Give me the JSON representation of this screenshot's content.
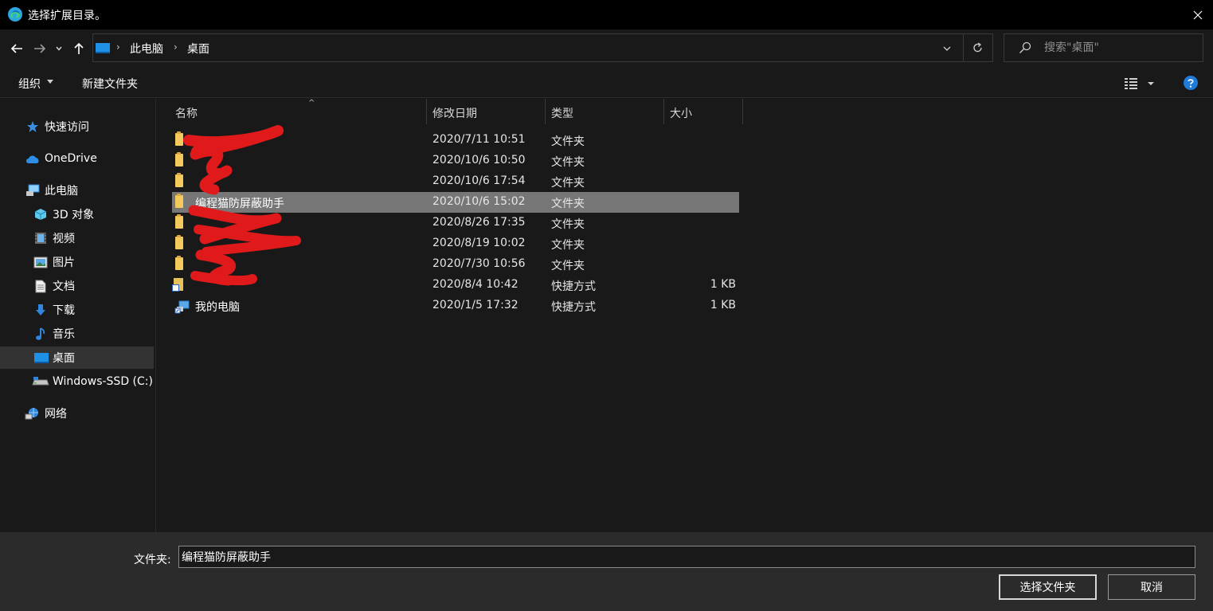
{
  "window": {
    "title": "选择扩展目录。"
  },
  "breadcrumb": {
    "items": [
      "此电脑",
      "桌面"
    ]
  },
  "search": {
    "placeholder": "搜索\"桌面\""
  },
  "toolbar": {
    "organize_label": "组织",
    "new_folder_label": "新建文件夹"
  },
  "sidebar": {
    "items": [
      {
        "label": "快速访问",
        "icon": "star-icon"
      },
      {
        "label": "OneDrive",
        "icon": "cloud-icon"
      },
      {
        "label": "此电脑",
        "icon": "computer-icon"
      },
      {
        "label": "3D 对象",
        "icon": "cube-icon"
      },
      {
        "label": "视频",
        "icon": "video-icon"
      },
      {
        "label": "图片",
        "icon": "picture-icon"
      },
      {
        "label": "文档",
        "icon": "document-icon"
      },
      {
        "label": "下载",
        "icon": "download-icon"
      },
      {
        "label": "音乐",
        "icon": "music-icon"
      },
      {
        "label": "桌面",
        "icon": "desktop-icon"
      },
      {
        "label": "Windows-SSD (C:)",
        "icon": "drive-icon"
      },
      {
        "label": "网络",
        "icon": "network-icon"
      }
    ],
    "selected": "桌面"
  },
  "columns": {
    "name": "名称",
    "date": "修改日期",
    "type": "类型",
    "size": "大小"
  },
  "files": [
    {
      "name": "",
      "date": "2020/7/11 10:51",
      "type": "文件夹",
      "size": "",
      "kind": "folder"
    },
    {
      "name": "",
      "date": "2020/10/6 10:50",
      "type": "文件夹",
      "size": "",
      "kind": "folder"
    },
    {
      "name": "",
      "date": "2020/10/6 17:54",
      "type": "文件夹",
      "size": "",
      "kind": "folder"
    },
    {
      "name": "编程猫防屏蔽助手",
      "date": "2020/10/6 15:02",
      "type": "文件夹",
      "size": "",
      "kind": "folder",
      "selected": true
    },
    {
      "name": "",
      "date": "2020/8/26 17:35",
      "type": "文件夹",
      "size": "",
      "kind": "folder"
    },
    {
      "name": "",
      "date": "2020/8/19 10:02",
      "type": "文件夹",
      "size": "",
      "kind": "folder"
    },
    {
      "name": "",
      "date": "2020/7/30 10:56",
      "type": "文件夹",
      "size": "",
      "kind": "folder"
    },
    {
      "name": "",
      "date": "2020/8/4 10:42",
      "type": "快捷方式",
      "size": "1 KB",
      "kind": "shortcut"
    },
    {
      "name": "我的电脑",
      "date": "2020/1/5 17:32",
      "type": "快捷方式",
      "size": "1 KB",
      "kind": "computer-shortcut"
    }
  ],
  "footer": {
    "folder_label": "文件夹:",
    "folder_value": "编程猫防屏蔽助手",
    "select_button": "选择文件夹",
    "cancel_button": "取消"
  },
  "colors": {
    "background": "#191919",
    "titlebar": "#000000",
    "selection": "#777777",
    "footer": "#2b2b2b",
    "redaction": "#e01a1a",
    "help_blue": "#1f7ad8"
  }
}
